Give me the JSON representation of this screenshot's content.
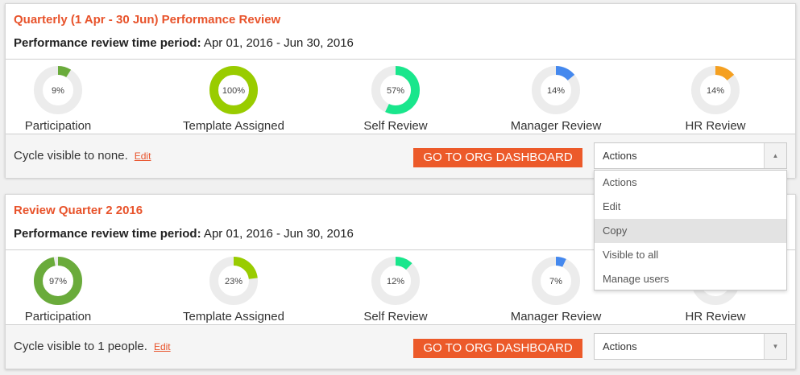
{
  "colors": {
    "accent": "#e8532b",
    "button": "#ec5a2a",
    "track": "#ececec"
  },
  "reviews": [
    {
      "title": "Quarterly (1 Apr - 30 Jun) Performance Review",
      "period_label": "Performance review time period:",
      "period_value": " Apr 01, 2016 - Jun 30, 2016",
      "metrics": [
        {
          "label": "Participation",
          "value": 9,
          "value_text": "9%",
          "color": "#6aab3b"
        },
        {
          "label": "Template Assigned",
          "value": 100,
          "value_text": "100%",
          "color": "#99cc00"
        },
        {
          "label": "Self Review",
          "value": 57,
          "value_text": "57%",
          "color": "#19e68c"
        },
        {
          "label": "Manager Review",
          "value": 14,
          "value_text": "14%",
          "color": "#4488ee"
        },
        {
          "label": "HR Review",
          "value": 14,
          "value_text": "14%",
          "color": "#f5a020"
        }
      ],
      "visibility_text": "Cycle visible to none.",
      "edit_label": "Edit",
      "dashboard_button": "GO TO ORG DASHBOARD",
      "actions_value": "Actions",
      "arrow": "▲"
    },
    {
      "title": "Review Quarter 2 2016",
      "period_label": "Performance review time period:",
      "period_value": " Apr 01, 2016 - Jun 30, 2016",
      "metrics": [
        {
          "label": "Participation",
          "value": 97,
          "value_text": "97%",
          "color": "#6aab3b"
        },
        {
          "label": "Template Assigned",
          "value": 23,
          "value_text": "23%",
          "color": "#99cc00"
        },
        {
          "label": "Self Review",
          "value": 12,
          "value_text": "12%",
          "color": "#19e68c"
        },
        {
          "label": "Manager Review",
          "value": 7,
          "value_text": "7%",
          "color": "#4488ee"
        },
        {
          "label": "HR Review",
          "value": 0,
          "value_text": "",
          "color": "#f5a020"
        }
      ],
      "visibility_text": "Cycle visible to 1 people.",
      "edit_label": "Edit",
      "dashboard_button": "GO TO ORG DASHBOARD",
      "actions_value": "Actions",
      "arrow": "▼"
    }
  ],
  "actions_menu": {
    "items": [
      "Actions",
      "Edit",
      "Copy",
      "Visible to all",
      "Manage users"
    ],
    "highlighted": "Copy"
  }
}
